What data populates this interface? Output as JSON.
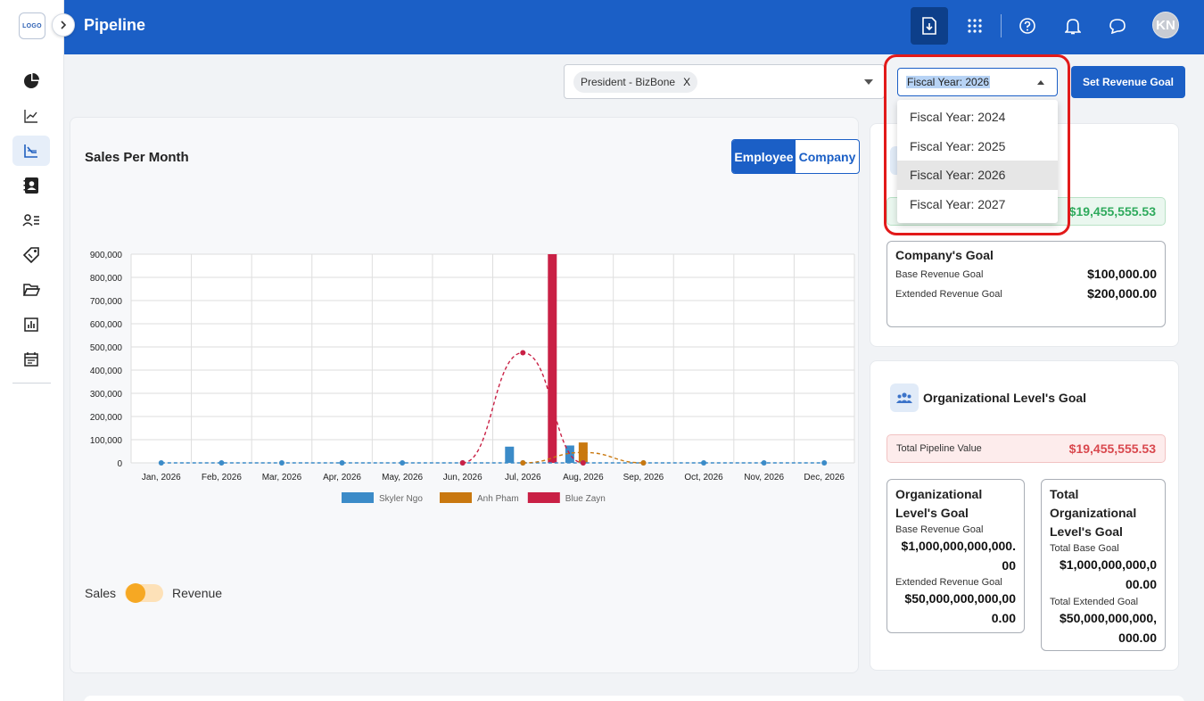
{
  "app": {
    "logo_text": "LOGO"
  },
  "sidebar": {
    "items": [
      {
        "name": "pie-chart-icon"
      },
      {
        "name": "trend-line-icon"
      },
      {
        "name": "pipeline-chart-icon",
        "active": true
      },
      {
        "name": "contacts-book-icon"
      },
      {
        "name": "user-list-icon"
      },
      {
        "name": "tag-icon"
      },
      {
        "name": "folder-open-icon"
      },
      {
        "name": "bar-report-icon"
      },
      {
        "name": "calendar-icon"
      }
    ]
  },
  "header": {
    "title": "Pipeline",
    "avatar_initials": "KN",
    "icons": [
      "export-icon",
      "apps-grid-icon",
      "help-icon",
      "bell-icon",
      "chat-icon"
    ]
  },
  "filters": {
    "chip_label": "President - BizBone",
    "chip_remove": "X",
    "fiscal_year_value": "Fiscal Year: 2026",
    "set_goal_label": "Set Revenue Goal",
    "fiscal_year_options": [
      "Fiscal Year: 2024",
      "Fiscal Year: 2025",
      "Fiscal Year: 2026",
      "Fiscal Year: 2027"
    ],
    "selected_index": 2
  },
  "chart_card": {
    "title": "Sales Per Month",
    "toggle": {
      "employee": "Employee",
      "company": "Company",
      "active": "employee"
    },
    "switch": {
      "left": "Sales",
      "right": "Revenue"
    }
  },
  "chart_data": {
    "type": "bar",
    "title": "Sales Per Month",
    "categories": [
      "Jan, 2026",
      "Feb, 2026",
      "Mar, 2026",
      "Apr, 2026",
      "May, 2026",
      "Jun, 2026",
      "Jul, 2026",
      "Aug, 2026",
      "Sep, 2026",
      "Oct, 2026",
      "Nov, 2026",
      "Dec, 2026"
    ],
    "yticks": [
      "900,000",
      "800,000",
      "700,000",
      "600,000",
      "500,000",
      "400,000",
      "300,000",
      "200,000",
      "100,000",
      "0"
    ],
    "ylim": [
      0,
      900000
    ],
    "grid": true,
    "legend_position": "bottom",
    "series": [
      {
        "name": "Skyler Ngo",
        "color": "#3b8bc8",
        "values": [
          0,
          0,
          0,
          0,
          0,
          0,
          70000,
          75000,
          0,
          0,
          0,
          0
        ],
        "trend": [
          0,
          0,
          0,
          0,
          0,
          0,
          0,
          0,
          0,
          0,
          0,
          0
        ]
      },
      {
        "name": "Anh Pham",
        "color": "#c9780f",
        "values": [
          0,
          0,
          0,
          0,
          0,
          0,
          0,
          88000,
          0,
          0,
          0,
          0
        ],
        "trend": [
          null,
          null,
          null,
          null,
          null,
          null,
          0,
          45000,
          0,
          null,
          null,
          null
        ]
      },
      {
        "name": "Blue Zayn",
        "color": "#c92045",
        "values": [
          0,
          0,
          0,
          0,
          0,
          0,
          900000,
          0,
          0,
          0,
          0,
          0
        ],
        "trend": [
          null,
          null,
          null,
          null,
          null,
          0,
          475000,
          0,
          null,
          null,
          null,
          null
        ]
      }
    ]
  },
  "company_card": {
    "pipeline_value": "$19,455,555.53",
    "pipeline_value_color": "#2eaa5c",
    "goal_title": "Company's Goal",
    "base_label": "Base Revenue Goal",
    "base_value": "$100,000.00",
    "extended_label": "Extended Revenue Goal",
    "extended_value": "$200,000.00"
  },
  "org_card": {
    "title": "Organizational Level's Goal",
    "pipeline_label": "Total Pipeline Value",
    "pipeline_value": "$19,455,555.53",
    "pipeline_value_color": "#d9484e",
    "left": {
      "title_l1": "Organizational",
      "title_l2": "Level's Goal",
      "base_label": "Base Revenue Goal",
      "base_l1": "$1,000,000,000,000.",
      "base_l2": "00",
      "ext_label": "Extended Revenue Goal",
      "ext_l1": "$50,000,000,000,00",
      "ext_l2": "0.00"
    },
    "right": {
      "title_l1": "Total",
      "title_l2": "Organizational",
      "title_l3": "Level's Goal",
      "base_label": "Total Base Goal",
      "base_l1": "$1,000,000,000,0",
      "base_l2": "00.00",
      "ext_label": "Total Extended Goal",
      "ext_l1": "$50,000,000,000,",
      "ext_l2": "000.00"
    }
  }
}
